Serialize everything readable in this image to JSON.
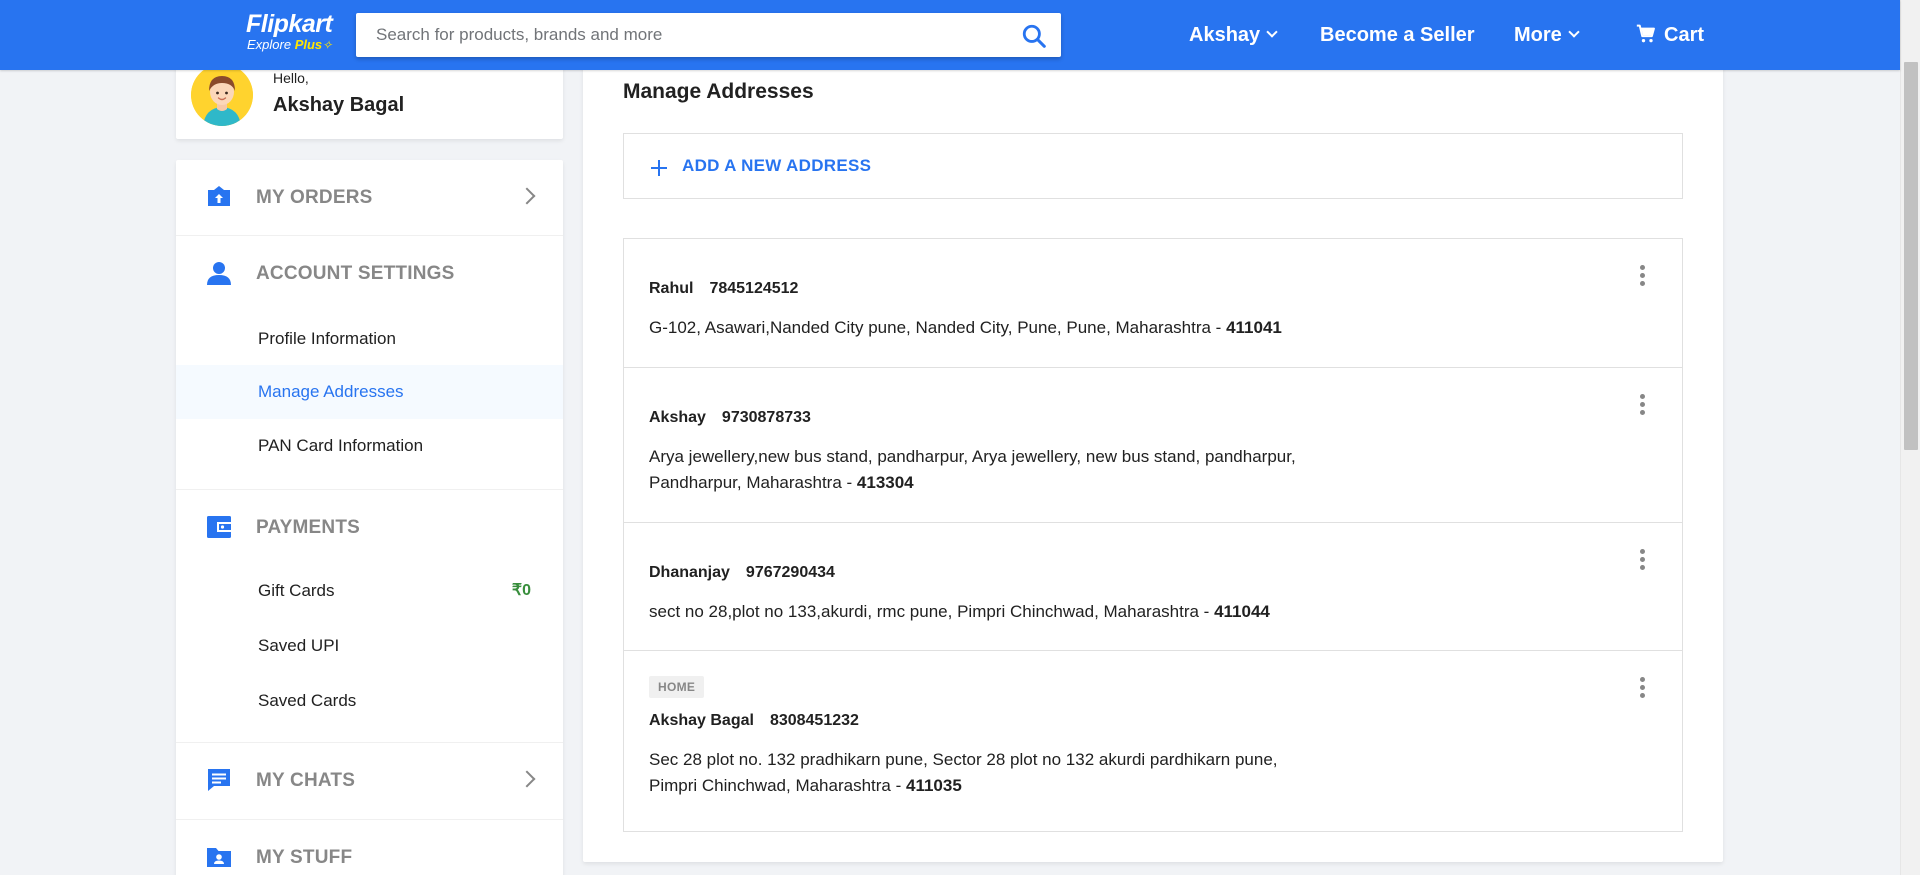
{
  "header": {
    "logo_main": "Flipkart",
    "logo_explore": "Explore",
    "logo_plus": "Plus",
    "search_placeholder": "Search for products, brands and more",
    "user_label": "Akshay",
    "seller_label": "Become a Seller",
    "more_label": "More",
    "cart_label": "Cart",
    "colors": {
      "brand": "#2874f0",
      "accent": "#ffe500"
    }
  },
  "sidebar": {
    "greeting": "Hello,",
    "user_name": "Akshay Bagal",
    "sections": [
      {
        "title": "MY ORDERS",
        "icon": "orders-icon",
        "items": []
      },
      {
        "title": "ACCOUNT SETTINGS",
        "icon": "user-icon",
        "items": [
          {
            "label": "Profile Information"
          },
          {
            "label": "Manage Addresses",
            "active": true
          },
          {
            "label": "PAN Card Information"
          }
        ]
      },
      {
        "title": "PAYMENTS",
        "icon": "wallet-icon",
        "items": [
          {
            "label": "Gift Cards",
            "value": "₹0"
          },
          {
            "label": "Saved UPI"
          },
          {
            "label": "Saved Cards"
          }
        ]
      },
      {
        "title": "MY CHATS",
        "icon": "chat-icon",
        "items": []
      },
      {
        "title": "MY STUFF",
        "icon": "folder-user-icon",
        "items": []
      }
    ]
  },
  "main": {
    "title": "Manage Addresses",
    "add_label": "ADD A NEW ADDRESS",
    "addresses": [
      {
        "tag": "",
        "name": "Rahul",
        "phone": "7845124512",
        "address": "G-102, Asawari,Nanded City pune, Nanded City, Pune, Pune, Maharashtra - ",
        "pincode": "411041"
      },
      {
        "tag": "",
        "name": "Akshay",
        "phone": "9730878733",
        "address": "Arya jewellery,new bus stand, pandharpur, Arya jewellery, new bus stand, pandharpur, Pandharpur, Maharashtra - ",
        "pincode": "413304"
      },
      {
        "tag": "",
        "name": "Dhananjay",
        "phone": "9767290434",
        "address": "sect no 28,plot no 133,akurdi, rmc pune, Pimpri Chinchwad, Maharashtra - ",
        "pincode": "411044"
      },
      {
        "tag": "HOME",
        "name": "Akshay Bagal",
        "phone": "8308451232",
        "address": "Sec 28 plot no. 132 pradhikarn pune, Sector 28 plot no 132 akurdi pardhikarn pune, Pimpri Chinchwad, Maharashtra - ",
        "pincode": "411035"
      }
    ]
  }
}
